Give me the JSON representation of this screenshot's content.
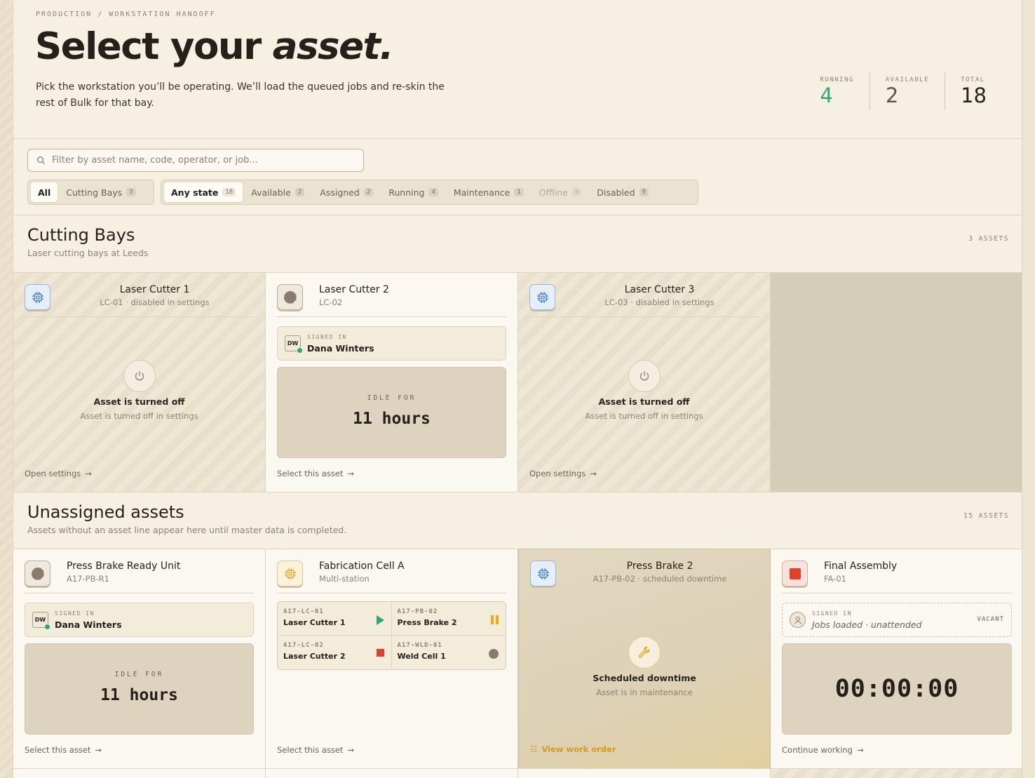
{
  "header": {
    "breadcrumb": "PRODUCTION / WORKSTATION HANDOFF",
    "title_plain": "Select your ",
    "title_italic": "asset.",
    "subtitle": "Pick the workstation you’ll be operating. We’ll load the queued jobs and re-skin the rest of Bulk for that bay."
  },
  "stats": {
    "running": {
      "label": "RUNNING",
      "value": "4"
    },
    "available": {
      "label": "AVAILABLE",
      "value": "2"
    },
    "total": {
      "label": "TOTAL",
      "value": "18"
    }
  },
  "search": {
    "placeholder": "Filter by asset name, code, operator, or job...",
    "value": ""
  },
  "line_filter": [
    {
      "label": "All",
      "count": "",
      "active": true
    },
    {
      "label": "Cutting Bays",
      "count": "3",
      "active": false
    }
  ],
  "state_filter": [
    {
      "label": "Any state",
      "count": "18"
    },
    {
      "label": "Available",
      "count": "2"
    },
    {
      "label": "Assigned",
      "count": "2"
    },
    {
      "label": "Running",
      "count": "4"
    },
    {
      "label": "Maintenance",
      "count": "1"
    },
    {
      "label": "Offline",
      "count": "0"
    },
    {
      "label": "Disabled",
      "count": "9"
    }
  ],
  "sections": [
    {
      "title": "Cutting Bays",
      "subtitle": "Laser cutting bays at Leeds",
      "count": "3 ASSETS"
    },
    {
      "title": "Unassigned assets",
      "subtitle": "Assets without an asset line appear here until master data is completed.",
      "count": "15 ASSETS"
    }
  ],
  "cards": {
    "lc1": {
      "name": "Laser Cutter 1",
      "code": "LC-01 · disabled in settings",
      "state_title": "Asset is turned off",
      "state_sub": "Asset is turned off in settings",
      "link": "Open settings",
      "icon": "chip-icon"
    },
    "lc2": {
      "name": "Laser Cutter 2",
      "code": "LC-02",
      "signin_label": "SIGNED IN",
      "operator": "Dana Winters",
      "initials": "DW",
      "idle_label": "IDLE FOR",
      "idle_value": "11 hours",
      "link": "Select this asset",
      "icon": "idle-octagon-icon"
    },
    "lc3": {
      "name": "Laser Cutter 3",
      "code": "LC-03 · disabled in settings",
      "state_title": "Asset is turned off",
      "state_sub": "Asset is turned off in settings",
      "link": "Open settings",
      "icon": "chip-icon"
    },
    "pbr": {
      "name": "Press Brake Ready Unit",
      "code": "A17-PB-R1",
      "signin_label": "SIGNED IN",
      "operator": "Dana Winters",
      "initials": "DW",
      "idle_label": "IDLE FOR",
      "idle_value": "11 hours",
      "link": "Select this asset"
    },
    "fab": {
      "name": "Fabrication Cell A",
      "code": "Multi-station",
      "link": "Select this asset",
      "stations": [
        {
          "code": "A17-LC-01",
          "name": "Laser Cutter 1",
          "status": "running"
        },
        {
          "code": "A17-PB-02",
          "name": "Press Brake 2",
          "status": "paused"
        },
        {
          "code": "A17-LC-02",
          "name": "Laser Cutter 2",
          "status": "stopped"
        },
        {
          "code": "A17-WLD-01",
          "name": "Weld Cell 1",
          "status": "idle"
        }
      ]
    },
    "pb2": {
      "name": "Press Brake 2",
      "code": "A17-PB-02 · scheduled downtime",
      "state_title": "Scheduled downtime",
      "state_sub": "Asset is in maintenance",
      "link": "View work order"
    },
    "fa": {
      "name": "Final Assembly",
      "code": "FA-01",
      "signin_label": "SIGNED IN",
      "operator": "Jobs loaded · unattended",
      "vacant": "VACANT",
      "timer": "00:00:00",
      "link": "Continue working"
    }
  },
  "colors": {
    "running": "#2fa37a",
    "paused": "#f2a916",
    "stopped": "#e0412f",
    "idle": "#8a7b6e",
    "accent_gold": "#d69b1c"
  }
}
